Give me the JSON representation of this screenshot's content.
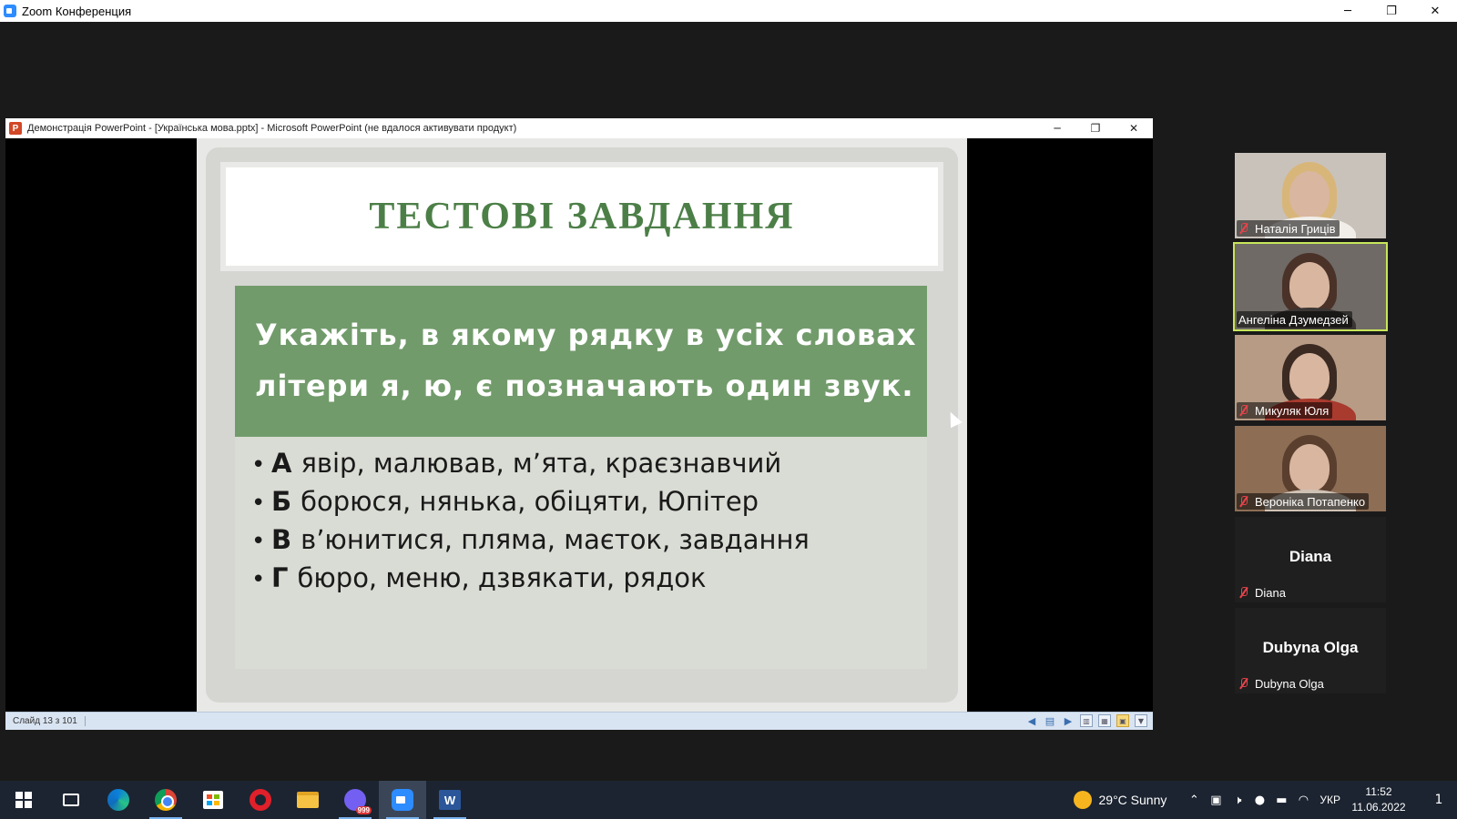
{
  "zoom": {
    "title": "Zoom Конференция",
    "controls": {
      "minimize": "─",
      "restore": "❐",
      "close": "✕"
    }
  },
  "ppt": {
    "title": "Демонстрація PowerPoint - [Українська мова.pptx] - Microsoft PowerPoint (не вдалося активувати продукт)",
    "icon_letter": "P",
    "controls": {
      "minimize": "─",
      "restore": "❐",
      "close": "✕"
    },
    "status": {
      "slide_counter": "Слайд 13 з 101"
    }
  },
  "slide": {
    "title": "ТЕСТОВІ ЗАВДАННЯ",
    "question_line1": "Укажіть, в якому рядку в усіх словах",
    "question_line2": "літери я, ю, є позначають один звук.",
    "answers": [
      {
        "letter": "А",
        "text": "явір, малював, м’ята, краєзнавчий"
      },
      {
        "letter": "Б",
        "text": "борюся, нянька, обіцяти, Юпітер"
      },
      {
        "letter": "В",
        "text": "в’юнитися, пляма, маєток, завдання"
      },
      {
        "letter": "Г",
        "text": "бюро, меню, дзвякати, рядок"
      }
    ],
    "bullet": "•"
  },
  "participants": [
    {
      "name": "Наталія Гриців",
      "video": true,
      "muted": true,
      "active": false,
      "bg": "#c9c2bb",
      "hair": "#d8b67a",
      "body": "#f1eee9"
    },
    {
      "name": "Ангеліна Дзумедзей",
      "video": true,
      "muted": false,
      "active": true,
      "bg": "#6f6a66",
      "hair": "#4a3228",
      "body": "#3b3634"
    },
    {
      "name": "Микуляк Юля",
      "video": true,
      "muted": true,
      "active": false,
      "bg": "#b79b85",
      "hair": "#3b2a22",
      "body": "#a83a2e"
    },
    {
      "name": "Вероніка  Потапенко",
      "video": true,
      "muted": true,
      "active": false,
      "bg": "#8d6e55",
      "hair": "#5b3f2e",
      "body": "#cfc2b4"
    },
    {
      "name": "Diana",
      "video": false,
      "muted": true,
      "active": false,
      "big_name": "Diana"
    },
    {
      "name": "Dubyna Olga",
      "video": false,
      "muted": true,
      "active": false,
      "big_name": "Dubyna Olga"
    }
  ],
  "taskbar": {
    "weather": {
      "temp": "29°C",
      "condition": "Sunny",
      "icon": "sun-icon"
    },
    "lang": "УКР",
    "time": "11:52",
    "date": "11.06.2022",
    "notifications": "1",
    "viber_badge": "999",
    "word_letter": "W",
    "tray_glyphs": {
      "chevron": "⌃",
      "meet": "▣",
      "volume": "🕨",
      "mic": "●",
      "battery": "▬",
      "wifi": "◠"
    }
  }
}
